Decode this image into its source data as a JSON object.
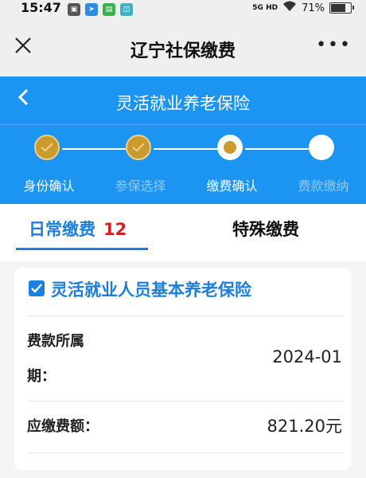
{
  "status": {
    "time": "15:47",
    "network": "5G HD",
    "battery": "71%"
  },
  "app": {
    "title": "辽宁社保缴费",
    "more": "•••"
  },
  "page": {
    "title": "灵活就业养老保险"
  },
  "steps": [
    {
      "label": "身份确认",
      "state": "done"
    },
    {
      "label": "参保选择",
      "state": "done"
    },
    {
      "label": "缴费确认",
      "state": "active"
    },
    {
      "label": "费款缴纳",
      "state": "todo"
    }
  ],
  "tabs": {
    "daily": {
      "label": "日常缴费",
      "count": "12"
    },
    "special": {
      "label": "特殊缴费"
    }
  },
  "item": {
    "title": "灵活就业人员基本养老保险",
    "checked": true,
    "period_label_1": "费款所属",
    "period_label_2": "期：",
    "period_value": "2024-01",
    "amount_label": "应缴费额：",
    "amount_value": "821.20元"
  },
  "colors": {
    "primary": "#1b94f2",
    "accent": "#1b7fe0",
    "step_done": "#c99a2d",
    "count": "#d02020"
  }
}
